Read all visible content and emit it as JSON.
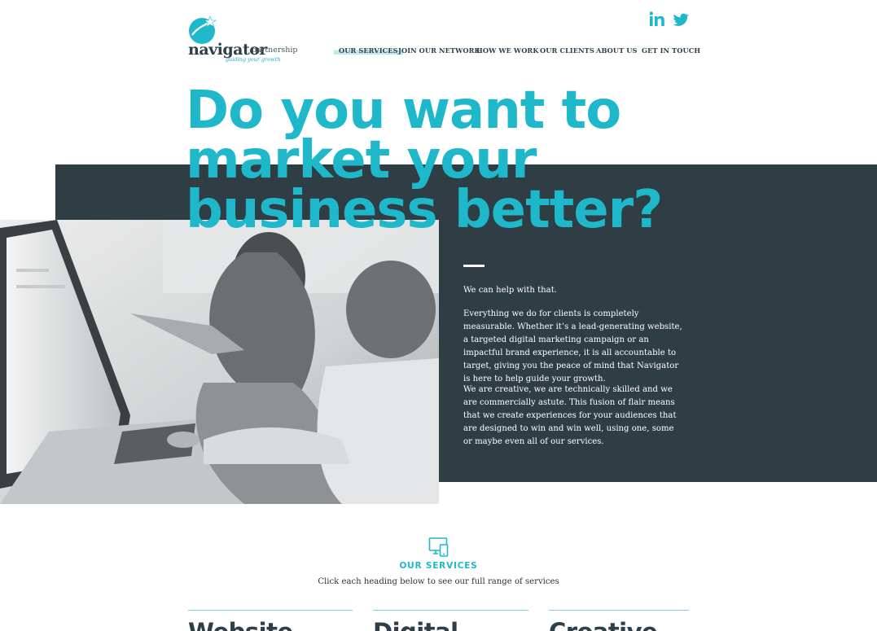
{
  "brand": {
    "name": "navigator",
    "suffix": "partnership",
    "tagline": "guiding your growth",
    "color_primary": "#1fb8cb",
    "color_dark": "#2f3d44"
  },
  "social": [
    {
      "icon": "linkedin-icon",
      "label": "in"
    },
    {
      "icon": "twitter-icon"
    }
  ],
  "nav": {
    "items": [
      {
        "label": "OUR SERVICES",
        "active": true
      },
      {
        "label": "JOIN OUR NETWORK"
      },
      {
        "label": "HOW WE WORK"
      },
      {
        "label": "OUR CLIENTS"
      },
      {
        "label": "ABOUT US"
      },
      {
        "label": "GET IN TOUCH"
      }
    ]
  },
  "hero": {
    "lines": [
      "Do you want to",
      "market your",
      "business better?"
    ]
  },
  "intro": {
    "p1": "We can help with that.",
    "p2": "Everything we do for clients is completely measurable. Whether it’s a lead-generating website, a targeted digital marketing campaign or an impactful brand experience, it is all accountable to target, giving you the peace of mind that Navigator is here to help guide your growth.",
    "p3": "We are creative, we are technically skilled and we are commercially astute. This fusion of flair means that we create experiences for your audiences that are designed to win and win well, using one, some or maybe even all of our services."
  },
  "services": {
    "icon": "devices-icon",
    "title": "OUR SERVICES",
    "subtitle": "Click each heading below to see our full range of services",
    "columns": [
      {
        "heading": "Website"
      },
      {
        "heading": "Digital"
      },
      {
        "heading": "Creative"
      }
    ]
  }
}
